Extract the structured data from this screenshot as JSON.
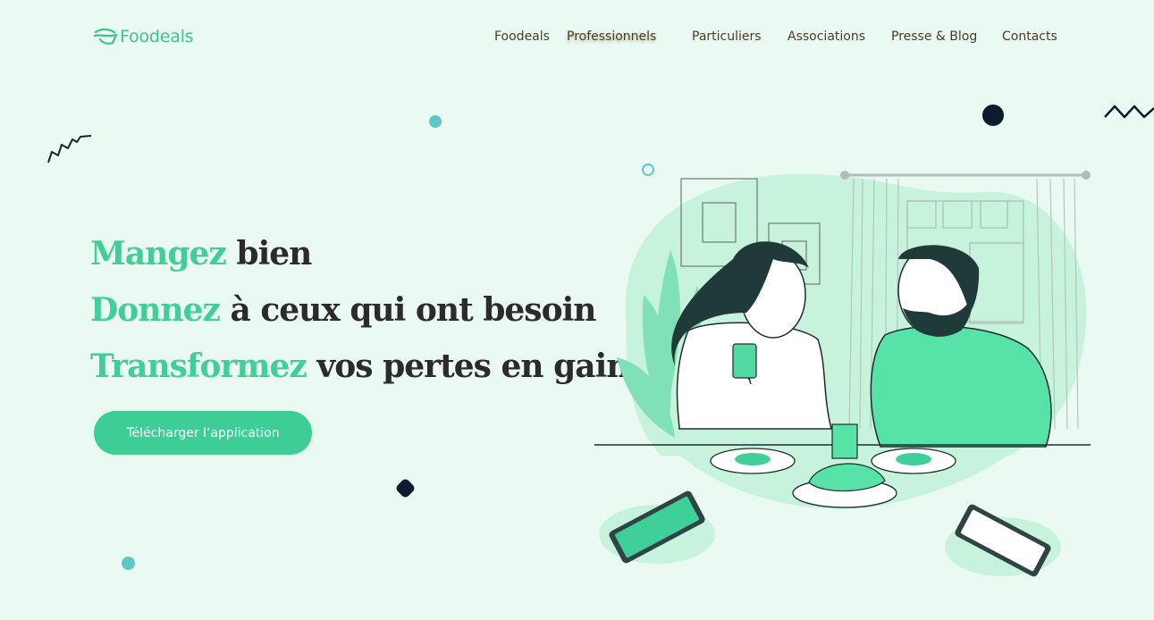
{
  "brand": {
    "name": "Foodeals",
    "accent": "#3cce95",
    "background": "#eafaf2",
    "dark": "#0d1b2e"
  },
  "nav": {
    "items": [
      {
        "label": "Foodeals"
      },
      {
        "label": "Professionnels",
        "active": true
      },
      {
        "label": "Particuliers"
      },
      {
        "label": "Associations"
      },
      {
        "label": "Presse & Blog"
      },
      {
        "label": "Contacts"
      }
    ]
  },
  "hero": {
    "lines": [
      {
        "accent": "Mangez",
        "rest": " bien"
      },
      {
        "accent": "Donnez",
        "rest": " à ceux qui ont besoin"
      },
      {
        "accent": "Transformez",
        "rest": " vos pertes en gain"
      }
    ],
    "cta_label": "Télécharger l’application"
  },
  "illustration": {
    "scene": "couple-eating-breakfast",
    "icons": [
      "phone-icon",
      "croissant-icon",
      "plant-icon"
    ]
  }
}
